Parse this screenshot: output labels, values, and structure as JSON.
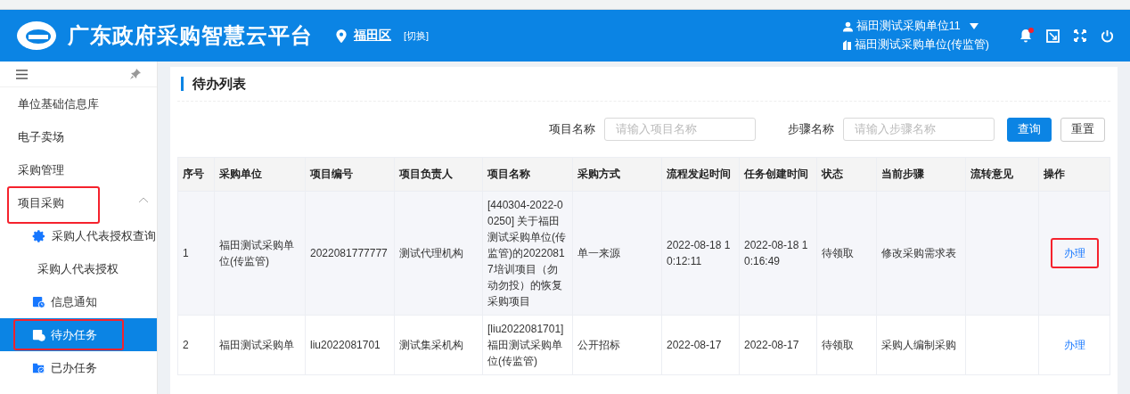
{
  "header": {
    "title": "广东政府采购智慧云平台",
    "region": "福田区",
    "switch_link": "[切换]",
    "user": "福田测试采购单位11",
    "organization": "福田测试采购单位(传监管)",
    "notification_dot": true
  },
  "sidebar": {
    "items": [
      {
        "label": "单位基础信息库",
        "selected": false,
        "highlighted": false
      },
      {
        "label": "电子卖场",
        "selected": false,
        "highlighted": false
      },
      {
        "label": "采购管理",
        "selected": false,
        "highlighted": false
      },
      {
        "label": "项目采购",
        "selected": false,
        "highlighted": true,
        "expanded": true,
        "children": [
          {
            "label": "采购人代表授权查询",
            "selected": false,
            "highlighted": false
          },
          {
            "label": "采购人代表授权",
            "selected": false,
            "highlighted": false
          },
          {
            "label": "信息通知",
            "selected": false,
            "highlighted": false
          },
          {
            "label": "待办任务",
            "selected": true,
            "highlighted": true
          },
          {
            "label": "已办任务",
            "selected": false,
            "highlighted": false
          }
        ]
      }
    ]
  },
  "panel": {
    "title": "待办列表",
    "filters": [
      {
        "label": "项目名称",
        "placeholder": "请输入项目名称"
      },
      {
        "label": "步骤名称",
        "placeholder": "请输入步骤名称"
      }
    ],
    "buttons": [
      {
        "label": "查询",
        "kind": "primary"
      },
      {
        "label": "重置",
        "kind": "default"
      }
    ],
    "table": {
      "columns": [
        "序号",
        "采购单位",
        "项目编号",
        "项目负责人",
        "项目名称",
        "采购方式",
        "流程发起时间",
        "任务创建时间",
        "状态",
        "当前步骤",
        "流转意见",
        "操作"
      ],
      "rows": [
        {
          "cells": [
            "1",
            "福田测试采购单位(传监管)",
            "2022081777777",
            "测试代理机构",
            "[440304-2022-00250] 关于福田测试采购单位(传监管)的20220817培训项目（勿动勿投）的恢复采购项目",
            "单一来源",
            "2022-08-18 10:12:11",
            "2022-08-18 10:16:49",
            "待领取",
            "修改采购需求表",
            ""
          ],
          "action": "办理",
          "action_highlighted": true,
          "hovered": true
        },
        {
          "cells": [
            "2",
            "福田测试采购单",
            "liu2022081701",
            "测试集采机构",
            "[liu2022081701] 福田测试采购单位(传监管)",
            "公开招标",
            "2022-08-17",
            "2022-08-17",
            "待领取",
            "采购人编制采购",
            ""
          ],
          "action": "办理",
          "action_highlighted": false,
          "hovered": false
        }
      ]
    }
  }
}
